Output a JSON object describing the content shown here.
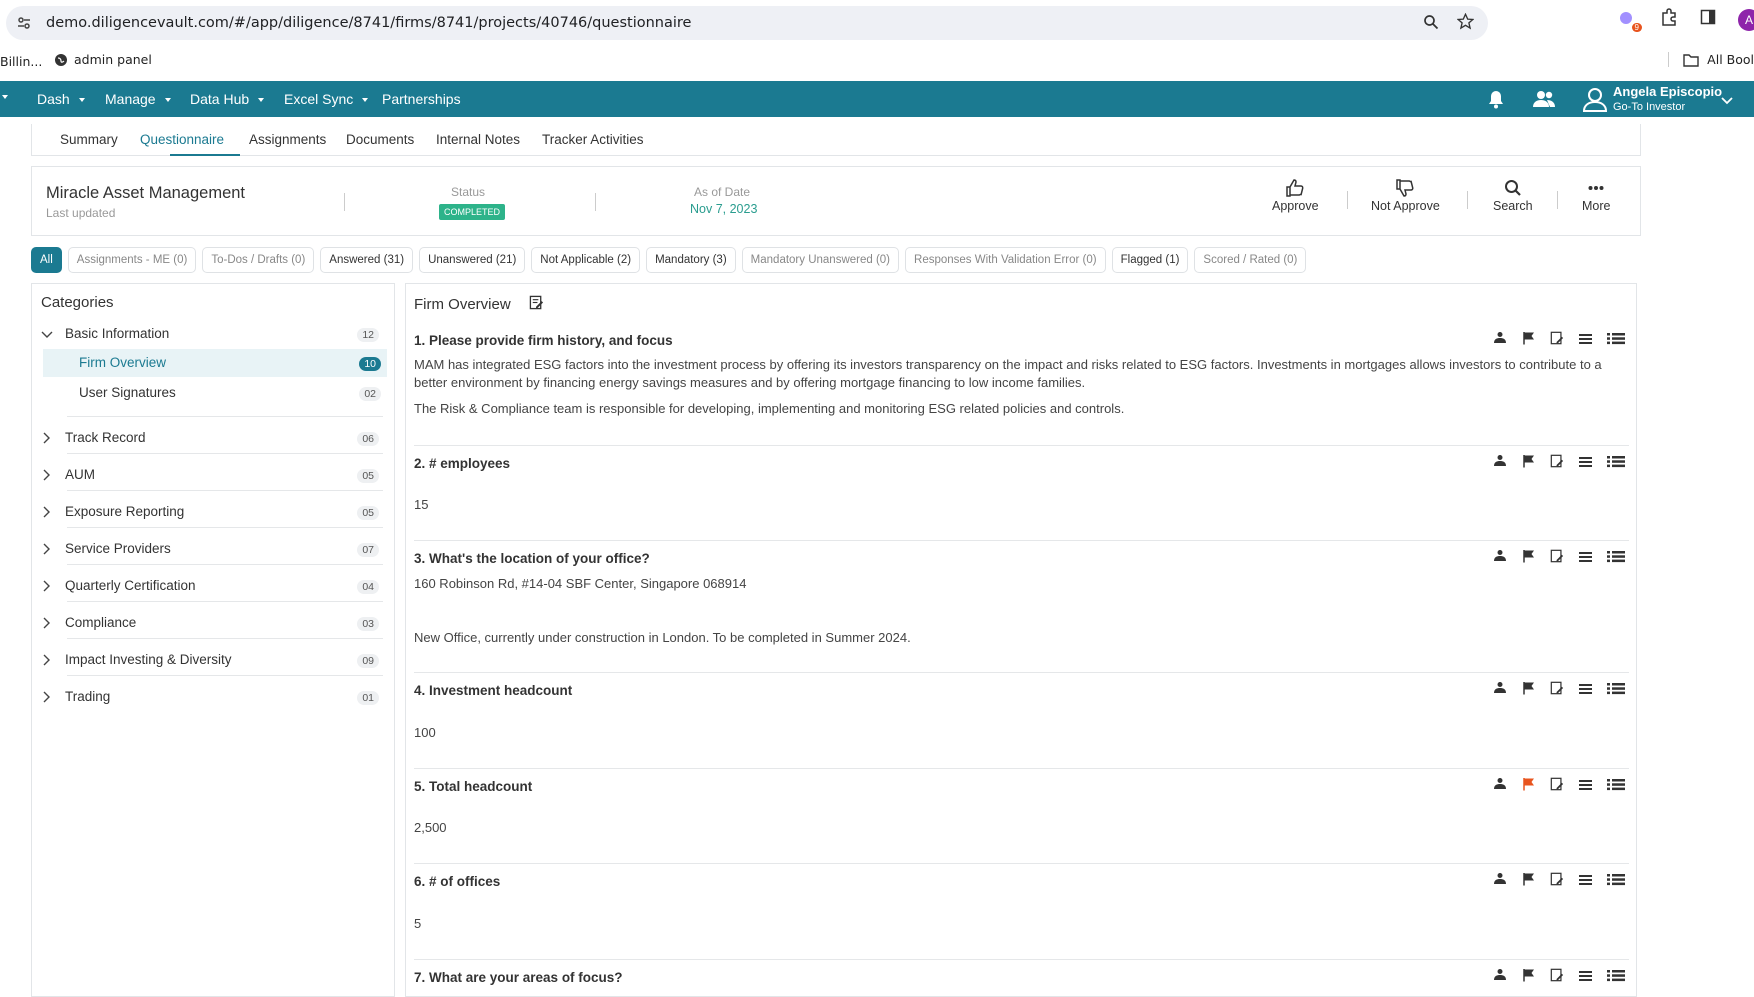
{
  "browser": {
    "url": "demo.diligencevault.com/#/app/diligence/8741/firms/8741/projects/40746/questionnaire",
    "ext_badge": "9",
    "profile_initial": "A"
  },
  "bookmarks": {
    "item1": "Billin...",
    "item2": "admin panel",
    "all_bookmarks": "All Bool"
  },
  "nav": {
    "items": [
      "Dash",
      "Manage",
      "Data Hub",
      "Excel Sync",
      "Partnerships"
    ],
    "user_name": "Angela Episcopio",
    "user_role": "Go-To Investor"
  },
  "tabs": [
    "Summary",
    "Questionnaire",
    "Assignments",
    "Documents",
    "Internal Notes",
    "Tracker Activities"
  ],
  "firm": {
    "name": "Miracle Asset Management",
    "last_updated": "Last updated",
    "status_label": "Status",
    "status": "COMPLETED",
    "as_of_label": "As of Date",
    "as_of": "Nov 7, 2023",
    "actions": [
      "Approve",
      "Not Approve",
      "Search",
      "More"
    ]
  },
  "filters": [
    "All",
    "Assignments - ME (0)",
    "To-Dos / Drafts (0)",
    "Answered (31)",
    "Unanswered (21)",
    "Not Applicable (2)",
    "Mandatory (3)",
    "Mandatory Unanswered (0)",
    "Responses With Validation Error (0)",
    "Flagged (1)",
    "Scored / Rated (0)"
  ],
  "categories": {
    "title": "Categories",
    "items": [
      {
        "label": "Basic Information",
        "count": "12"
      },
      {
        "label": "Firm Overview",
        "count": "10"
      },
      {
        "label": "User Signatures",
        "count": "02"
      },
      {
        "label": "Track Record",
        "count": "06"
      },
      {
        "label": "AUM",
        "count": "05"
      },
      {
        "label": "Exposure Reporting",
        "count": "05"
      },
      {
        "label": "Service Providers",
        "count": "07"
      },
      {
        "label": "Quarterly Certification",
        "count": "04"
      },
      {
        "label": "Compliance",
        "count": "03"
      },
      {
        "label": "Impact Investing & Diversity",
        "count": "09"
      },
      {
        "label": "Trading",
        "count": "01"
      }
    ]
  },
  "section": {
    "title": "Firm Overview",
    "questions": [
      {
        "title": "1. Please provide firm history, and focus",
        "answer1": "MAM has integrated ESG factors into the investment process by offering its investors transparency on the impact and risks related to ESG factors. Investments in mortgages allows investors to contribute to a better environment by financing energy savings measures and by offering mortgage financing to low income families.",
        "answer2": "The Risk & Compliance team is responsible for developing, implementing and monitoring ESG related policies and controls."
      },
      {
        "title": "2. # employees",
        "answer1": "15"
      },
      {
        "title": "3. What's the location of your office?",
        "answer1": "160 Robinson Rd, #14-04 SBF Center, Singapore 068914",
        "answer2": "New Office, currently under construction in London. To be completed in Summer 2024."
      },
      {
        "title": "4. Investment headcount",
        "answer1": "100"
      },
      {
        "title": "5. Total headcount",
        "answer1": "2,500"
      },
      {
        "title": "6. # of offices",
        "answer1": "5"
      },
      {
        "title": "7. What are your areas of focus?"
      }
    ]
  },
  "colors": {
    "brand": "#1b7a91",
    "status_green": "#2db38a",
    "flag_red": "#e8541e"
  }
}
